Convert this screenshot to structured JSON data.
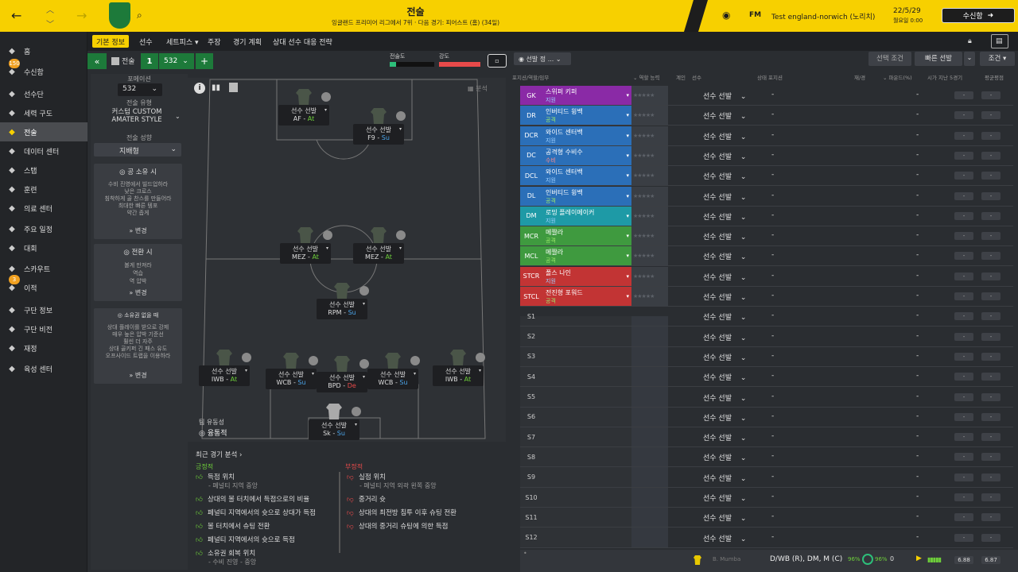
{
  "header": {
    "title": "전술",
    "subtitle": "잉글랜드 프리미어 리그에서 7위 · 다음 경기: 피어스트 (홈) (34일)",
    "game_name": "Test england-norwich (노리치)",
    "date": "22/5/29",
    "time": "월요일 0:00",
    "continue_label": "수신함",
    "fm_label": "FM"
  },
  "sidebar": {
    "items": [
      {
        "label": "홈",
        "icon": "home-icon"
      },
      {
        "label": "수신함",
        "icon": "inbox-icon",
        "badge": "150"
      },
      {
        "label": "선수단",
        "icon": "squad-icon"
      },
      {
        "label": "세력 구도",
        "icon": "dynamics-icon"
      },
      {
        "label": "전술",
        "icon": "tactics-icon"
      },
      {
        "label": "데이터 센터",
        "icon": "data-icon"
      },
      {
        "label": "스탭",
        "icon": "staff-icon"
      },
      {
        "label": "훈련",
        "icon": "training-icon"
      },
      {
        "label": "의료 센터",
        "icon": "medical-icon"
      },
      {
        "label": "주요 일정",
        "icon": "calendar-icon"
      },
      {
        "label": "대회",
        "icon": "trophy-icon"
      },
      {
        "label": "스카우트",
        "icon": "scout-icon"
      },
      {
        "label": "이적",
        "icon": "transfer-icon",
        "badge": "3"
      },
      {
        "label": "구단 정보",
        "icon": "club-icon"
      },
      {
        "label": "구단 비전",
        "icon": "vision-icon"
      },
      {
        "label": "재정",
        "icon": "finance-icon"
      },
      {
        "label": "육성 센터",
        "icon": "development-icon"
      }
    ]
  },
  "subnav": {
    "tabs": [
      "기본 정보",
      "선수",
      "세트피스 ▾",
      "주장",
      "경기 계획",
      "상대 선수 대응 전략"
    ]
  },
  "tactic_bar": {
    "label": "전술",
    "slot": "1",
    "formation": "532",
    "familiarity_label": "전술도",
    "intensity_label": "강도",
    "select_label": "선발 정 ...",
    "analysis_label": "분석"
  },
  "tactic_info": {
    "formation_label": "포메이션",
    "formation_value": "532",
    "style_label": "전술 유형",
    "style_value": "커스텀 CUSTOM AMATER STYLE",
    "mentality_label": "전술 성향",
    "mentality_value": "지배형",
    "in_possession": {
      "title": "공 소유 시",
      "lines": [
        "수비 진영에서 빌드업하라",
        "낮은 크로스",
        "침착하게 골 찬스를 만들어라",
        "최대한 빠른 템포",
        "약간 좁게"
      ],
      "change": "변경"
    },
    "transition": {
      "title": "전환 시",
      "lines": [
        "볼게 만져라",
        "역습",
        "역 압박"
      ],
      "change": "변경"
    },
    "out_possession": {
      "title": "소유권 없을 때",
      "lines": [
        "상대 플레이를 받으로 강제",
        "매우 높은 압박 기준선",
        "훨씬 더 자주",
        "상대 골키퍼 긴 패스 유도",
        "오프사이드 트랩을 이용하라"
      ],
      "change": "변경"
    },
    "fluidity_label": "팀 유동성",
    "fluidity_value": "융통적"
  },
  "players": [
    {
      "name": "선수 선발",
      "role": "AF",
      "duty": "At"
    },
    {
      "name": "선수 선발",
      "role": "F9",
      "duty": "Su"
    },
    {
      "name": "선수 선발",
      "role": "MEZ",
      "duty": "At"
    },
    {
      "name": "선수 선발",
      "role": "MEZ",
      "duty": "At"
    },
    {
      "name": "선수 선발",
      "role": "RPM",
      "duty": "Su"
    },
    {
      "name": "선수 선발",
      "role": "IWB",
      "duty": "At"
    },
    {
      "name": "선수 선발",
      "role": "WCB",
      "duty": "Su"
    },
    {
      "name": "선수 선발",
      "role": "BPD",
      "duty": "De"
    },
    {
      "name": "선수 선발",
      "role": "WCB",
      "duty": "Su"
    },
    {
      "name": "선수 선발",
      "role": "IWB",
      "duty": "At"
    },
    {
      "name": "선수 선발",
      "role": "Sk",
      "duty": "Su"
    }
  ],
  "analysis": {
    "title": "최근 경기 분석 ›",
    "positive_label": "긍정적",
    "negative_label": "부정적",
    "positive": [
      {
        "text": "득점 위치",
        "sub": "- 페널티 지역 중앙"
      },
      {
        "text": "상대의 볼 터치에서 득점으로의 비율",
        "sub": ""
      },
      {
        "text": "페널티 지역에서의 슛으로 상대가 득점",
        "sub": ""
      },
      {
        "text": "볼 터치에서 슈팅 전환",
        "sub": ""
      },
      {
        "text": "페널티 지역에서의 슛으로 득점",
        "sub": ""
      },
      {
        "text": "소유권 회복 위치",
        "sub": "- 수비 진영 - 중앙"
      }
    ],
    "negative": [
      {
        "text": "실점 위치",
        "sub": "- 페널티 지역 외곽 왼쪽 중앙"
      },
      {
        "text": "중거리 슛",
        "sub": ""
      },
      {
        "text": "상대의 최전방 침투 이후 슈팅 전환",
        "sub": ""
      },
      {
        "text": "상대의 중거리 슈팅에 의한 득점",
        "sub": ""
      }
    ]
  },
  "right_toolbar": {
    "selection_conditions": "선택 조건",
    "quick_pick": "빠른 선발",
    "conditions": "조건 ▾"
  },
  "table": {
    "headers": [
      "포지션/역할/임무",
      "역할 능력",
      "계인",
      "선수",
      "상태",
      "포지션",
      "재/경",
      "파운드(%)",
      "시가 지난 5경기",
      "평균평점"
    ],
    "select_label": "선수 선발",
    "dash": "-",
    "rows": [
      {
        "pos": "GK",
        "role": "스위퍼 키퍼",
        "duty": "지원",
        "color": "#8a2aa6"
      },
      {
        "pos": "DR",
        "role": "인버티드 윙백",
        "duty": "공격",
        "color": "#2b6fb8"
      },
      {
        "pos": "DCR",
        "role": "와이드 센터백",
        "duty": "지원",
        "color": "#2b6fb8"
      },
      {
        "pos": "DC",
        "role": "공격형 수비수",
        "duty": "수비",
        "color": "#2b6fb8"
      },
      {
        "pos": "DCL",
        "role": "와이드 센터백",
        "duty": "지원",
        "color": "#2b6fb8"
      },
      {
        "pos": "DL",
        "role": "인버티드 윙백",
        "duty": "공격",
        "color": "#2b6fb8"
      },
      {
        "pos": "DM",
        "role": "로밍 플레이메이커",
        "duty": "지원",
        "color": "#1e9aa6"
      },
      {
        "pos": "MCR",
        "role": "메짤라",
        "duty": "공격",
        "color": "#3f9a3f"
      },
      {
        "pos": "MCL",
        "role": "메짤라",
        "duty": "공격",
        "color": "#3f9a3f"
      },
      {
        "pos": "STCR",
        "role": "폴스 나인",
        "duty": "지원",
        "color": "#c23434"
      },
      {
        "pos": "STCL",
        "role": "전진형 포워드",
        "duty": "공격",
        "color": "#c23434"
      },
      {
        "pos": "S1",
        "role": "",
        "duty": "",
        "color": ""
      },
      {
        "pos": "S2",
        "role": "",
        "duty": "",
        "color": ""
      },
      {
        "pos": "S3",
        "role": "",
        "duty": "",
        "color": ""
      },
      {
        "pos": "S4",
        "role": "",
        "duty": "",
        "color": ""
      },
      {
        "pos": "S5",
        "role": "",
        "duty": "",
        "color": ""
      },
      {
        "pos": "S6",
        "role": "",
        "duty": "",
        "color": ""
      },
      {
        "pos": "S7",
        "role": "",
        "duty": "",
        "color": ""
      },
      {
        "pos": "S8",
        "role": "",
        "duty": "",
        "color": ""
      },
      {
        "pos": "S9",
        "role": "",
        "duty": "",
        "color": ""
      },
      {
        "pos": "S10",
        "role": "",
        "duty": "",
        "color": ""
      },
      {
        "pos": "S11",
        "role": "",
        "duty": "",
        "color": ""
      },
      {
        "pos": "S12",
        "role": "",
        "duty": "",
        "color": ""
      }
    ]
  },
  "footer": {
    "player": "B. Mumba",
    "positions": "D/WB (R), DM, M (C)",
    "pct1": "96%",
    "pct2": "96%",
    "zero": "0",
    "rating1": "6.88",
    "rating2": "6.87"
  },
  "colors": {
    "accent": "#f7d000",
    "positive": "#6ecf3a",
    "negative": "#e84a4a"
  }
}
